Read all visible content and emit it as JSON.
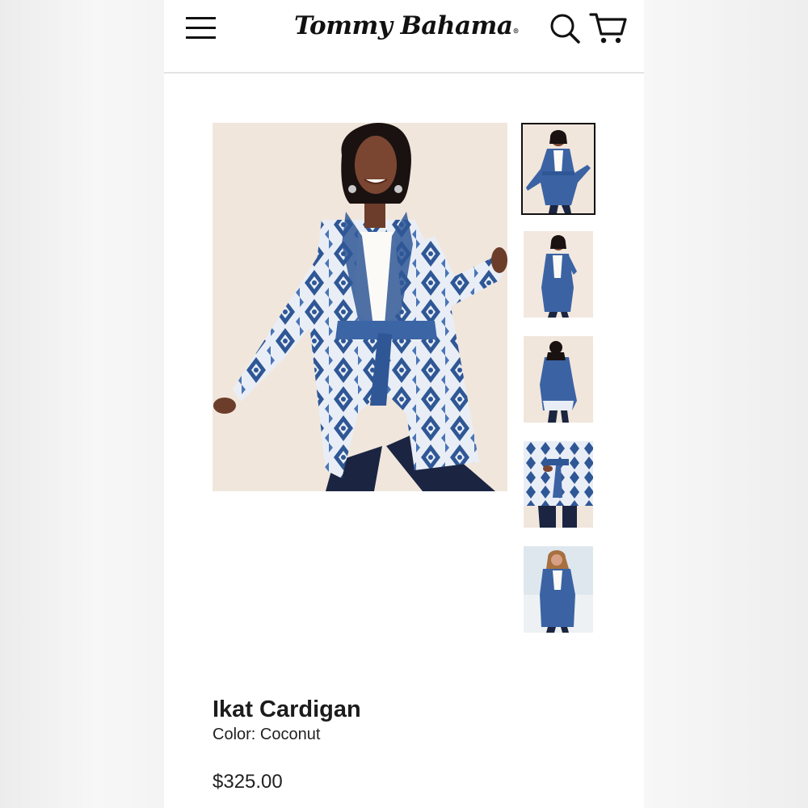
{
  "header": {
    "brand_name": "Tommy Bahama",
    "menu_icon": "hamburger-menu-icon",
    "search_icon": "search-icon",
    "cart_icon": "cart-icon"
  },
  "gallery": {
    "main_image_alt": "Ikat Cardigan",
    "thumbnails": [
      {
        "alt": "Ikat Cardigan front view",
        "selected": true
      },
      {
        "alt": "Ikat Cardigan side view",
        "selected": false
      },
      {
        "alt": "Ikat Cardigan back view",
        "selected": false
      },
      {
        "alt": "Ikat Cardigan detail view",
        "selected": false
      },
      {
        "alt": "Ikat Cardigan outdoor view",
        "selected": false
      }
    ]
  },
  "product": {
    "title": "Ikat Cardigan",
    "color_text": "Color: Coconut",
    "price": "$325.00"
  },
  "colors": {
    "pattern_blue": "#2f5796",
    "pattern_light": "#e9eef6",
    "pants_navy": "#1b2541",
    "background_peach": "#f1e6dc"
  }
}
